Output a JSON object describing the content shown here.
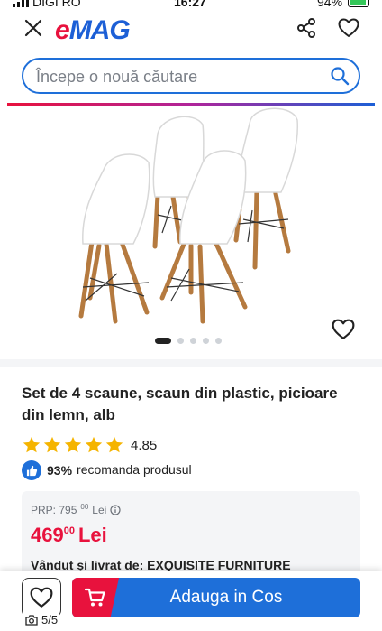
{
  "status_bar": {
    "carrier": "DIGI RO",
    "time": "16:27",
    "battery": "94%"
  },
  "header": {
    "logo": {
      "e": "e",
      "mag": "MAG"
    }
  },
  "search": {
    "placeholder": "Începe o nouă căutare"
  },
  "gallery": {
    "dots_total": 5,
    "active_index": 0
  },
  "product": {
    "title": "Set de 4 scaune, scaun din plastic, picioare din lemn, alb",
    "rating": "4.85",
    "stars": 5,
    "recommend_pct": "93%",
    "recommend_text": "recomanda produsul"
  },
  "price": {
    "prp_label": "PRP: 795",
    "prp_decimals": "00",
    "prp_currency": "Lei",
    "current_int": "469",
    "current_dec": "00",
    "current_currency": "Lei",
    "seller_prefix": "Vândut și livrat de:",
    "seller_name": "EXQUISITE FURNITURE"
  },
  "bottom_bar": {
    "photo_counter": "5/5",
    "cart_label": "Adauga in Cos"
  },
  "colors": {
    "brand_red": "#e8123d",
    "brand_blue": "#1c5fd6",
    "button_blue": "#1e6fd9",
    "star_yellow": "#f5b400"
  }
}
